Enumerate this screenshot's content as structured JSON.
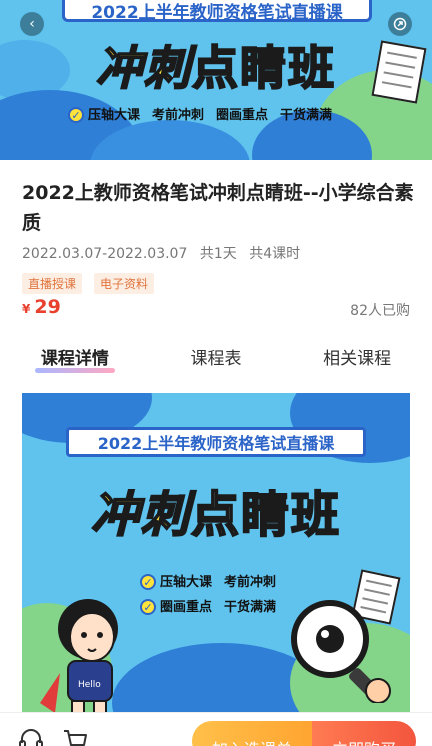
{
  "hero": {
    "chip_text": "2022上半年教师资格笔试直播课",
    "title_part1": "冲刺",
    "title_part2": "点睛班",
    "features": [
      "压轴大课",
      "考前冲刺",
      "圈画重点",
      "干货满满"
    ]
  },
  "nav": {
    "back_icon": "back-icon",
    "share_icon": "share-icon"
  },
  "course": {
    "title": "2022上教师资格笔试冲刺点睛班--小学综合素质",
    "date_range": "2022.03.07-2022.03.07",
    "days": "共1天",
    "lessons": "共4课时",
    "tags": [
      "直播授课",
      "电子资料"
    ],
    "currency": "¥",
    "price": "29",
    "buyers": "82人已购"
  },
  "tabs": [
    {
      "label": "课程详情",
      "active": true
    },
    {
      "label": "课程表",
      "active": false
    },
    {
      "label": "相关课程",
      "active": false
    }
  ],
  "poster": {
    "chip_text": "2022上半年教师资格笔试直播课",
    "title_part1": "冲刺",
    "title_part2": "点睛班",
    "features": [
      "压轴大课",
      "考前冲刺",
      "圈画重点",
      "干货满满"
    ],
    "shirt_text": "Hello"
  },
  "bottom_bar": {
    "add_label": "加入选课单",
    "buy_label": "立即购买"
  },
  "colors": {
    "accent_red": "#e8402d",
    "tag_bg": "#fdeee4",
    "tag_text": "#e0743d",
    "add_button": "#ffa531",
    "buy_button": "#f3553d",
    "banner_sky": "#5fc3ee",
    "banner_blue": "#2b64c8"
  }
}
